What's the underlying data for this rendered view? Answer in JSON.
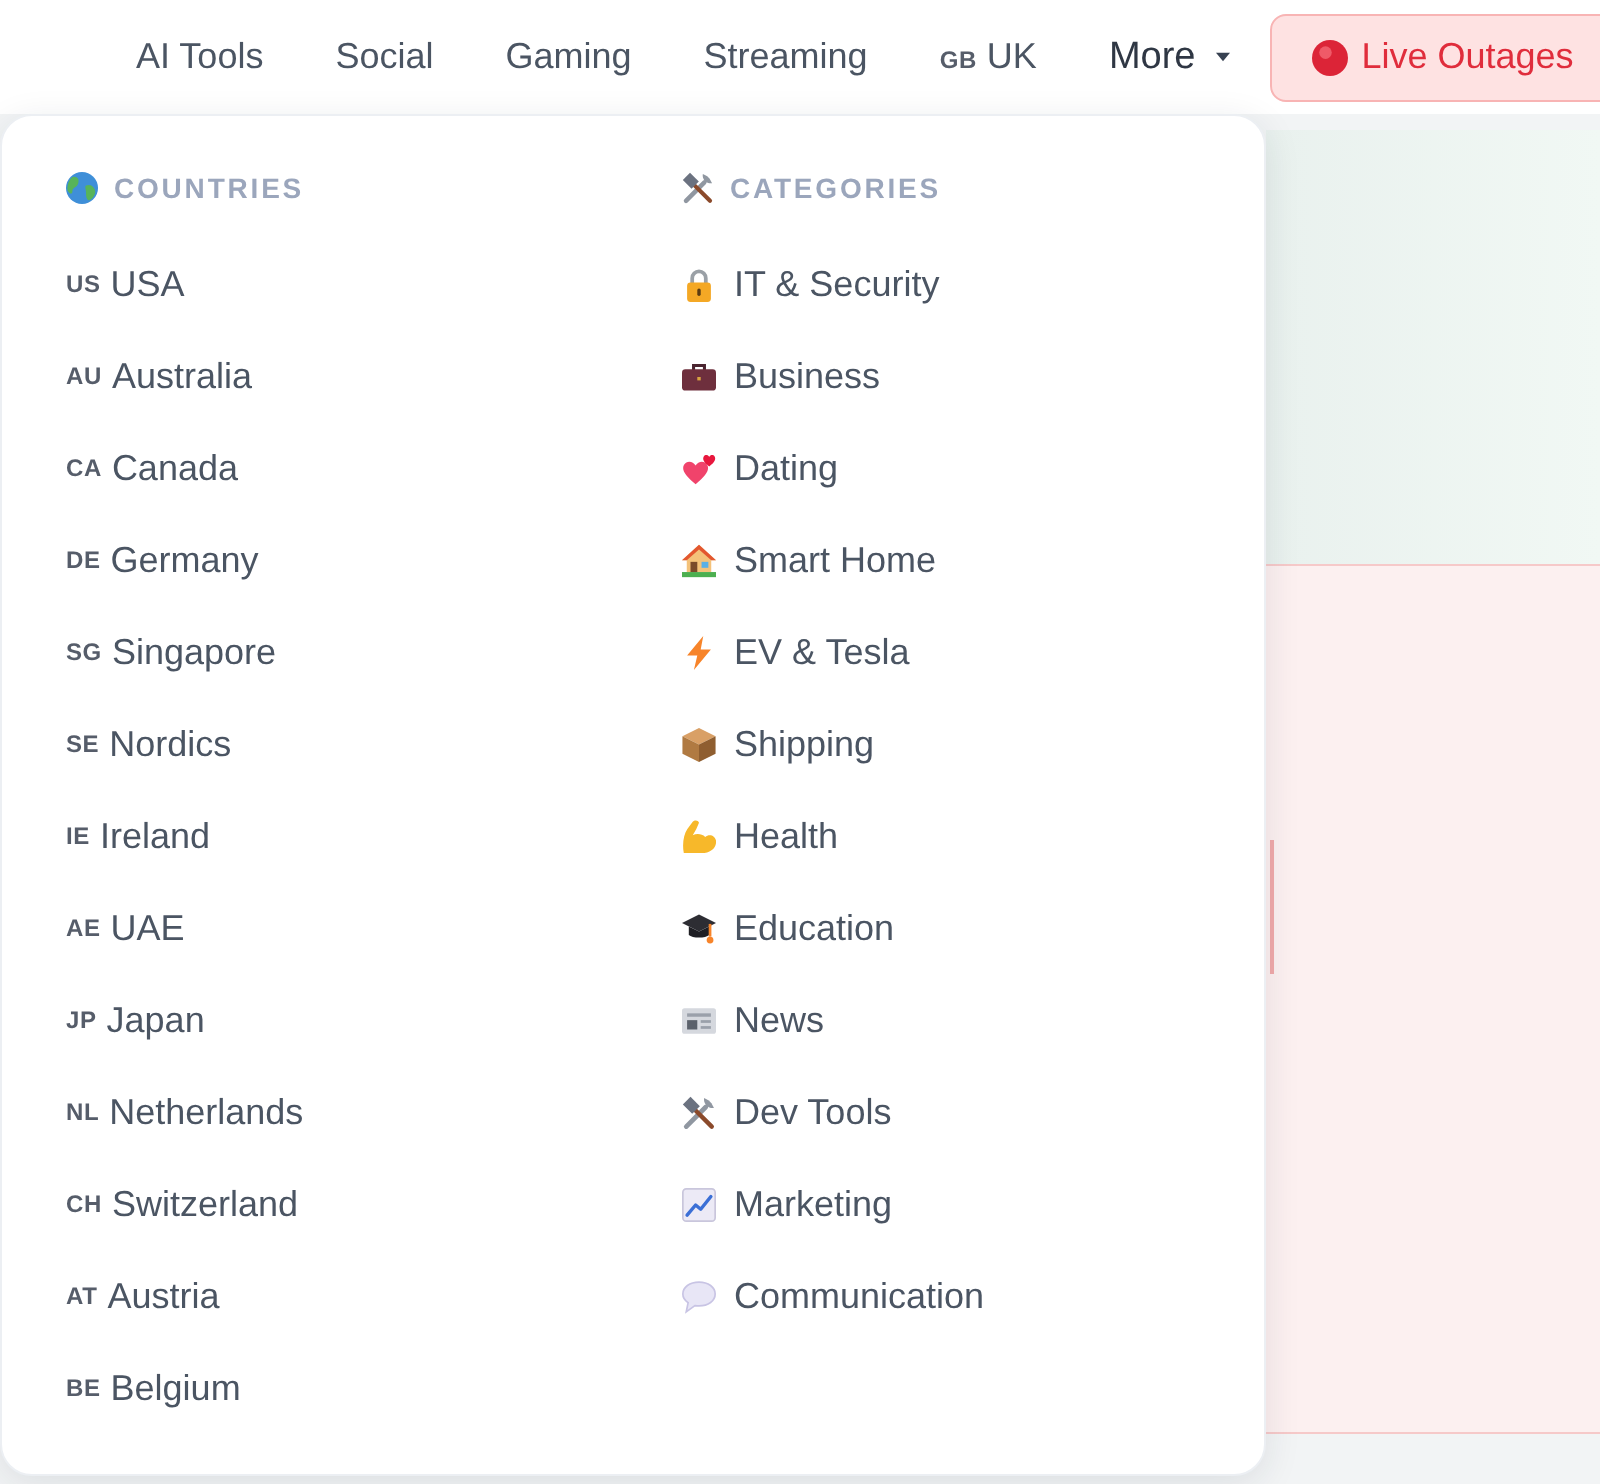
{
  "nav": {
    "links": [
      {
        "label": "AI Tools"
      },
      {
        "label": "Social"
      },
      {
        "label": "Gaming"
      },
      {
        "label": "Streaming"
      },
      {
        "code": "GB",
        "label": "UK"
      }
    ],
    "more": {
      "label": "More",
      "expanded": true
    },
    "live_button": {
      "label": "Live Outages"
    }
  },
  "menu": {
    "sections": [
      {
        "kind": "countries",
        "heading": "COUNTRIES",
        "items": [
          {
            "code": "US",
            "label": "USA"
          },
          {
            "code": "AU",
            "label": "Australia"
          },
          {
            "code": "CA",
            "label": "Canada"
          },
          {
            "code": "DE",
            "label": "Germany"
          },
          {
            "code": "SG",
            "label": "Singapore"
          },
          {
            "code": "SE",
            "label": "Nordics"
          },
          {
            "code": "IE",
            "label": "Ireland"
          },
          {
            "code": "AE",
            "label": "UAE"
          },
          {
            "code": "JP",
            "label": "Japan"
          },
          {
            "code": "NL",
            "label": "Netherlands"
          },
          {
            "code": "CH",
            "label": "Switzerland"
          },
          {
            "code": "AT",
            "label": "Austria"
          },
          {
            "code": "BE",
            "label": "Belgium"
          }
        ]
      },
      {
        "kind": "categories",
        "heading": "CATEGORIES",
        "items": [
          {
            "label": "IT & Security"
          },
          {
            "label": "Business"
          },
          {
            "label": "Dating"
          },
          {
            "label": "Smart Home"
          },
          {
            "label": "EV & Tesla"
          },
          {
            "label": "Shipping"
          },
          {
            "label": "Health"
          },
          {
            "label": "Education"
          },
          {
            "label": "News"
          },
          {
            "label": "Dev Tools"
          },
          {
            "label": "Marketing"
          },
          {
            "label": "Communication"
          }
        ]
      }
    ]
  }
}
